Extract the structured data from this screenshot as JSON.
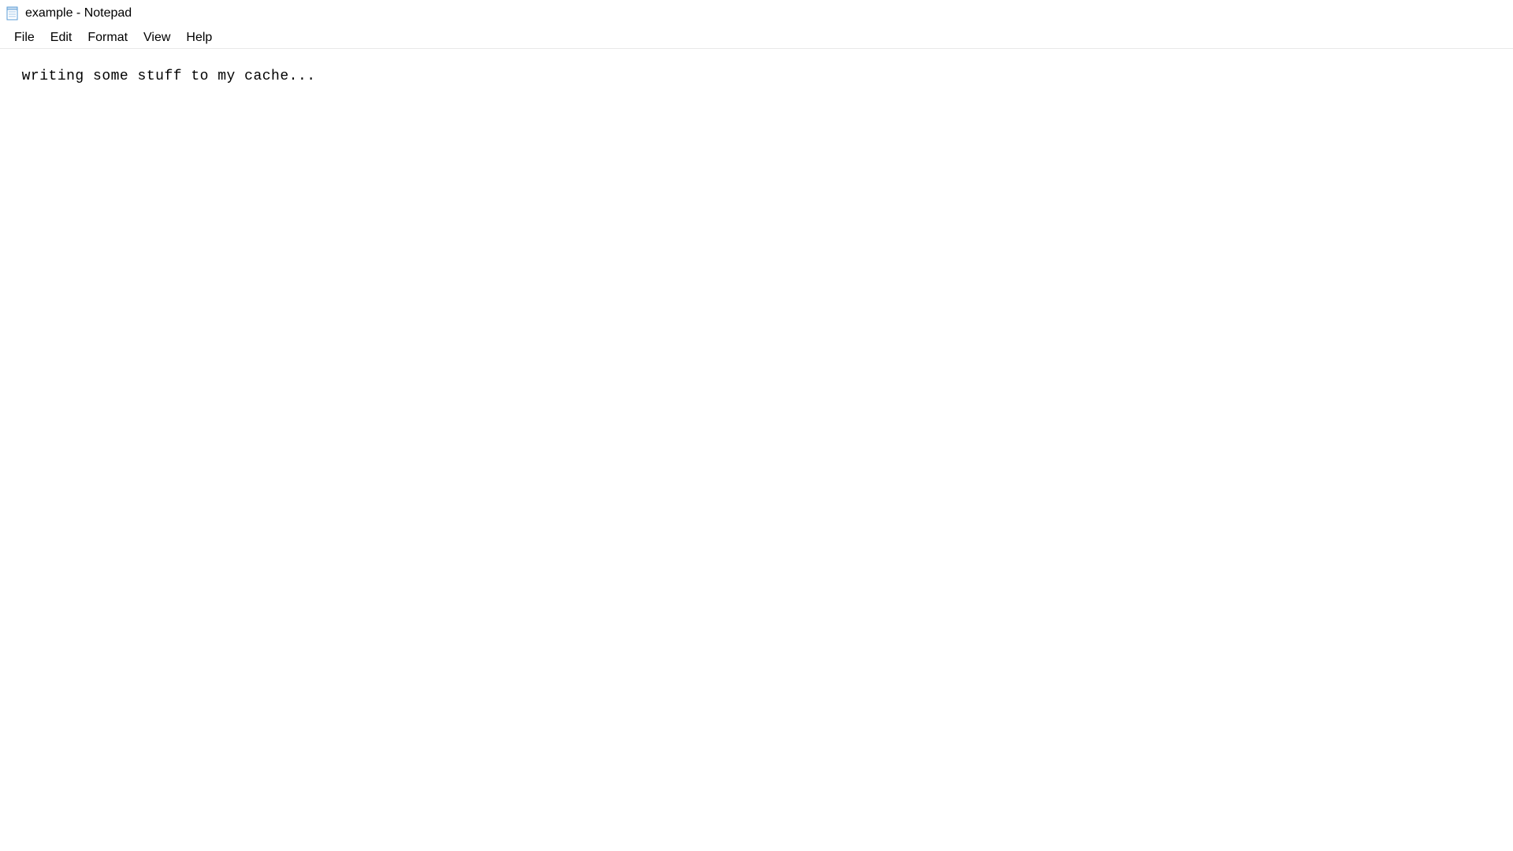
{
  "titlebar": {
    "title": "example - Notepad"
  },
  "menubar": {
    "items": [
      {
        "label": "File"
      },
      {
        "label": "Edit"
      },
      {
        "label": "Format"
      },
      {
        "label": "View"
      },
      {
        "label": "Help"
      }
    ]
  },
  "editor": {
    "content": "writing some stuff to my cache..."
  }
}
